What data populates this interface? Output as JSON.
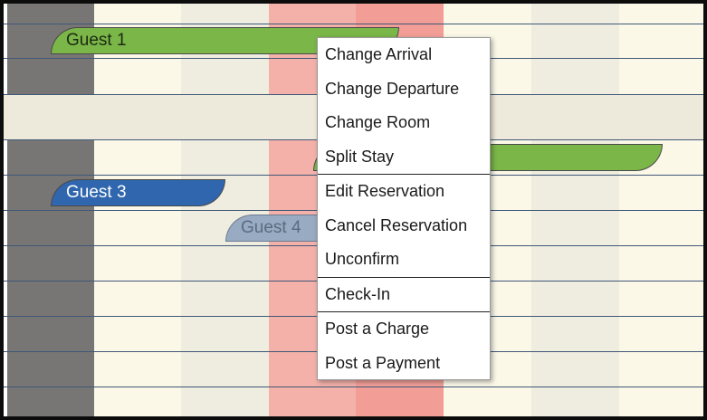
{
  "reservations": [
    {
      "label": "Guest 1",
      "color": "#7ab648",
      "state": "active"
    },
    {
      "label": "",
      "color": "#7ab648",
      "state": "active"
    },
    {
      "label": "Guest 3",
      "color": "#2f66ae",
      "state": "active"
    },
    {
      "label": "Guest 4",
      "color": "#98abc3",
      "state": "dimmed"
    }
  ],
  "context_menu": {
    "groups": [
      [
        "Change Arrival",
        "Change Departure",
        "Change Room",
        "Split Stay"
      ],
      [
        "Edit Reservation",
        "Cancel Reservation",
        "Unconfirm"
      ],
      [
        "Check-In"
      ],
      [
        "Post a Charge",
        "Post a Payment"
      ]
    ]
  },
  "colors": {
    "out_of_range_column": "#787674",
    "highlight_column": "#f4b1aa",
    "highlight_column_dark": "#f29e97",
    "row_line": "#3f5878"
  }
}
